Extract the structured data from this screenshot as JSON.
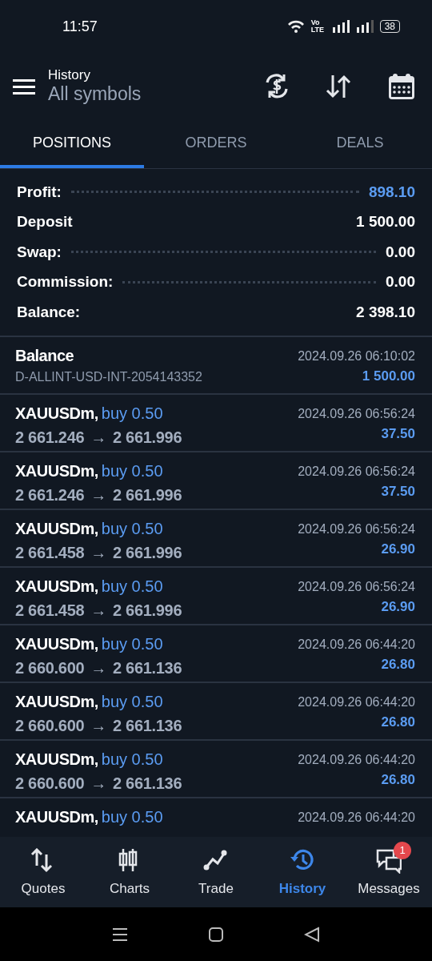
{
  "status_bar": {
    "time": "11:57",
    "network_label": "Vo LTE",
    "battery": "38"
  },
  "header": {
    "title": "History",
    "subtitle": "All symbols"
  },
  "tabs": [
    {
      "label": "POSITIONS",
      "selected": true
    },
    {
      "label": "ORDERS",
      "selected": false
    },
    {
      "label": "DEALS",
      "selected": false
    }
  ],
  "summary": [
    {
      "label": "Profit:",
      "value": "898.10",
      "dotted": true,
      "highlight": true
    },
    {
      "label": "Deposit",
      "value": "1 500.00",
      "dotted": false,
      "highlight": false
    },
    {
      "label": "Swap:",
      "value": "0.00",
      "dotted": true,
      "highlight": false
    },
    {
      "label": "Commission:",
      "value": "0.00",
      "dotted": true,
      "highlight": false
    },
    {
      "label": "Balance:",
      "value": "2 398.10",
      "dotted": false,
      "highlight": false
    }
  ],
  "rows": [
    {
      "kind": "balance",
      "title": "Balance",
      "detail": "D-ALLINT-USD-INT-2054143352",
      "time": "2024.09.26 06:10:02",
      "amount": "1 500.00"
    },
    {
      "kind": "trade",
      "symbol": "XAUUSDm,",
      "trade": "buy 0.50",
      "open_price": "2 661.246",
      "close_price": "2 661.996",
      "arrow": "→",
      "time": "2024.09.26 06:56:24",
      "amount": "37.50"
    },
    {
      "kind": "trade",
      "symbol": "XAUUSDm,",
      "trade": "buy 0.50",
      "open_price": "2 661.246",
      "close_price": "2 661.996",
      "arrow": "→",
      "time": "2024.09.26 06:56:24",
      "amount": "37.50"
    },
    {
      "kind": "trade",
      "symbol": "XAUUSDm,",
      "trade": "buy 0.50",
      "open_price": "2 661.458",
      "close_price": "2 661.996",
      "arrow": "→",
      "time": "2024.09.26 06:56:24",
      "amount": "26.90"
    },
    {
      "kind": "trade",
      "symbol": "XAUUSDm,",
      "trade": "buy 0.50",
      "open_price": "2 661.458",
      "close_price": "2 661.996",
      "arrow": "→",
      "time": "2024.09.26 06:56:24",
      "amount": "26.90"
    },
    {
      "kind": "trade",
      "symbol": "XAUUSDm,",
      "trade": "buy 0.50",
      "open_price": "2 660.600",
      "close_price": "2 661.136",
      "arrow": "→",
      "time": "2024.09.26 06:44:20",
      "amount": "26.80"
    },
    {
      "kind": "trade",
      "symbol": "XAUUSDm,",
      "trade": "buy 0.50",
      "open_price": "2 660.600",
      "close_price": "2 661.136",
      "arrow": "→",
      "time": "2024.09.26 06:44:20",
      "amount": "26.80"
    },
    {
      "kind": "trade",
      "symbol": "XAUUSDm,",
      "trade": "buy 0.50",
      "open_price": "2 660.600",
      "close_price": "2 661.136",
      "arrow": "→",
      "time": "2024.09.26 06:44:20",
      "amount": "26.80"
    },
    {
      "kind": "trade",
      "symbol": "XAUUSDm,",
      "trade": "buy 0.50",
      "time": "2024.09.26 06:44:20"
    }
  ],
  "bottom_nav": [
    {
      "label": "Quotes",
      "selected": false
    },
    {
      "label": "Charts",
      "selected": false
    },
    {
      "label": "Trade",
      "selected": false
    },
    {
      "label": "History",
      "selected": true
    },
    {
      "label": "Messages",
      "selected": false,
      "badge": "1"
    }
  ]
}
